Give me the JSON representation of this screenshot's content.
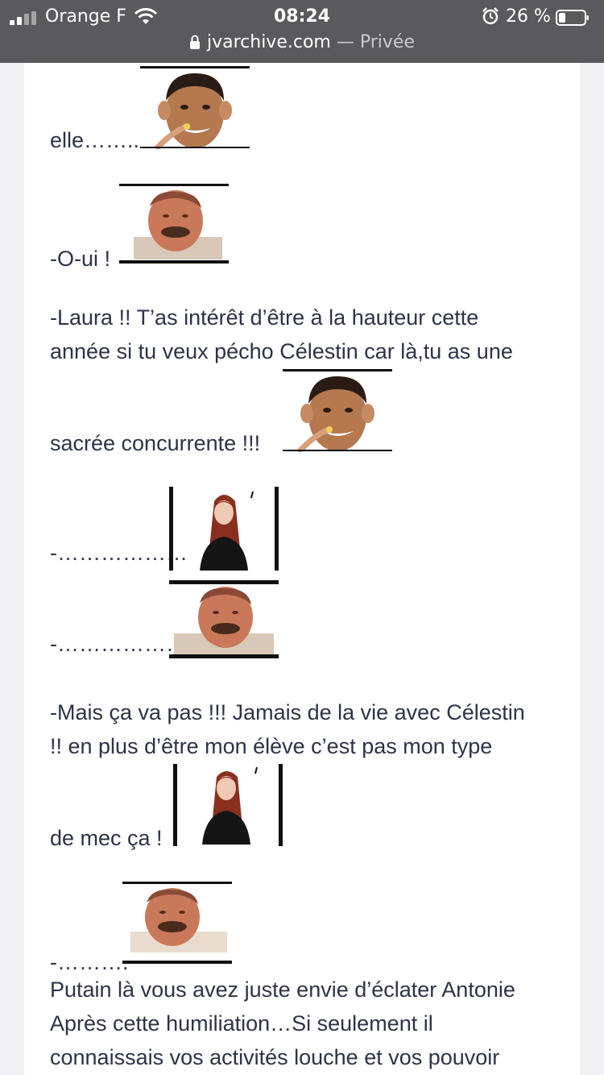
{
  "status_bar": {
    "carrier": "Orange F",
    "time": "08:24",
    "battery_percent": "26 %"
  },
  "url_bar": {
    "domain": "jvarchive.com",
    "separator": " — ",
    "mode": "Privée"
  },
  "post": {
    "lines": [
      "elle……..",
      "-O-ui !",
      "-Laura !! T’as intérêt d’être à la hauteur cette",
      "année si tu veux pécho Célestin car là,tu as une",
      "sacrée concurrente !!!",
      "-………………",
      "-………………",
      "-Mais ça va pas !!! Jamais de la vie avec Célestin",
      "!! en plus d’être mon élève c’est pas mon type",
      "de mec ça !",
      "-……….",
      "Putain là vous avez juste envie d’éclater Antonie",
      "Après cette humiliation…Si seulement il",
      "connaissais vos activités louche et vos pouvoir"
    ]
  },
  "colors": {
    "status_bar_bg": "#5a5a5c",
    "page_bg": "#f1f1f4",
    "text": "#2e3346"
  },
  "icons": [
    "signal-icon",
    "wifi-icon",
    "alarm-icon",
    "battery-icon",
    "lock-icon",
    "ronaldo-sticker",
    "risitas-sticker",
    "redhead-girl-sticker"
  ]
}
